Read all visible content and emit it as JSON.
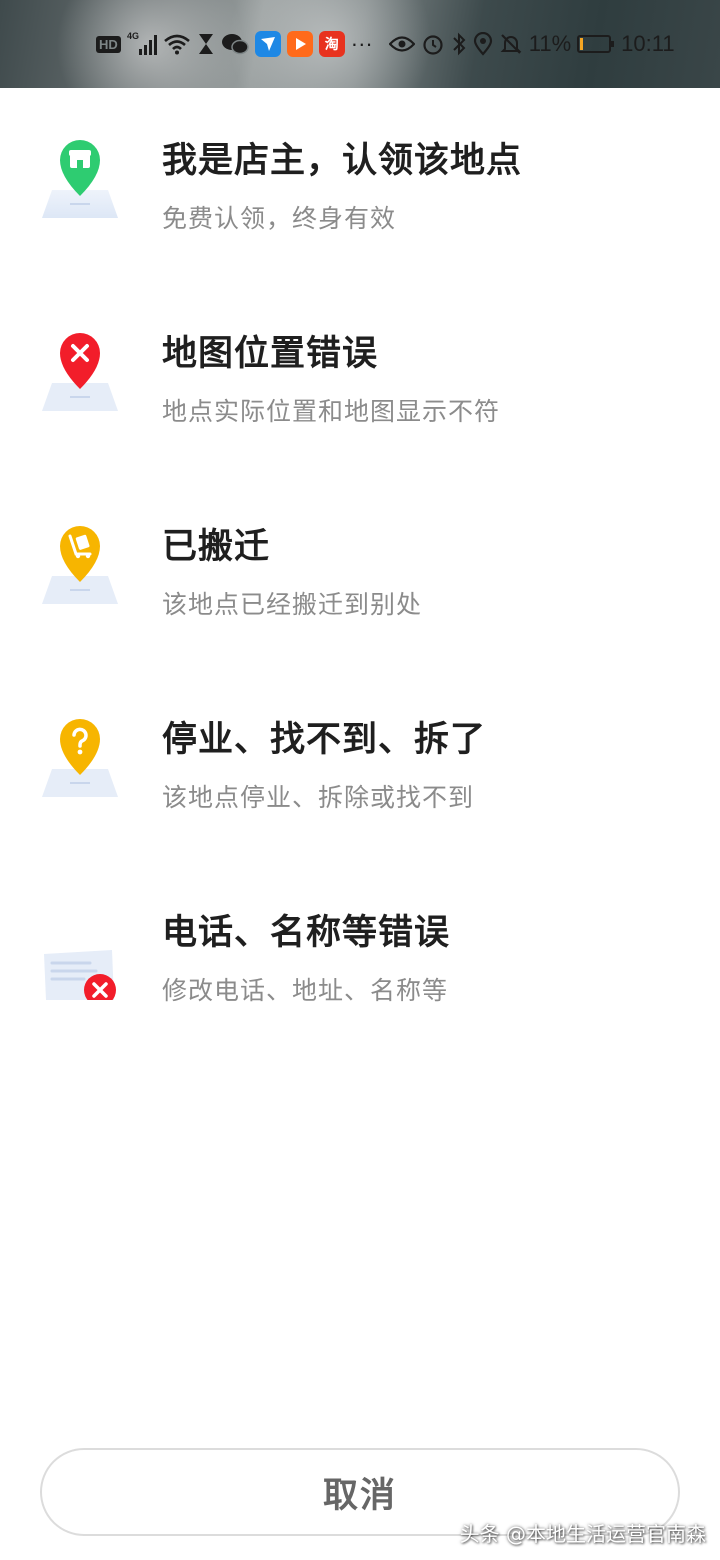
{
  "status_bar": {
    "network": "4G",
    "hd_label": "HD",
    "battery_text": "11%",
    "battery_level": 0.11,
    "time": "10:11",
    "more": "···",
    "taobao_char": "淘",
    "icons": [
      "hd-icon",
      "signal-icon",
      "wifi-icon",
      "hourglass-icon",
      "wechat-icon",
      "feishu-icon",
      "video-app-icon",
      "taobao-icon",
      "eye-icon",
      "alarm-icon",
      "bluetooth-icon",
      "location-icon",
      "mute-icon",
      "battery-icon"
    ]
  },
  "options": [
    {
      "title": "我是店主，认领该地点",
      "subtitle": "免费认领，终身有效",
      "icon": "store-pin-icon",
      "color": "#2ecc71"
    },
    {
      "title": "地图位置错误",
      "subtitle": "地点实际位置和地图显示不符",
      "icon": "error-pin-icon",
      "color": "#f21d2a"
    },
    {
      "title": "已搬迁",
      "subtitle": "该地点已经搬迁到别处",
      "icon": "moving-cart-pin-icon",
      "color": "#f7b500"
    },
    {
      "title": "停业、找不到、拆了",
      "subtitle": "该地点停业、拆除或找不到",
      "icon": "question-pin-icon",
      "color": "#f7b500"
    },
    {
      "title": "电话、名称等错误",
      "subtitle": "修改电话、地址、名称等",
      "icon": "info-card-error-icon",
      "color": "#f21d2a"
    }
  ],
  "cancel_label": "取消",
  "watermark": "头条 @本地生活运营官南森"
}
